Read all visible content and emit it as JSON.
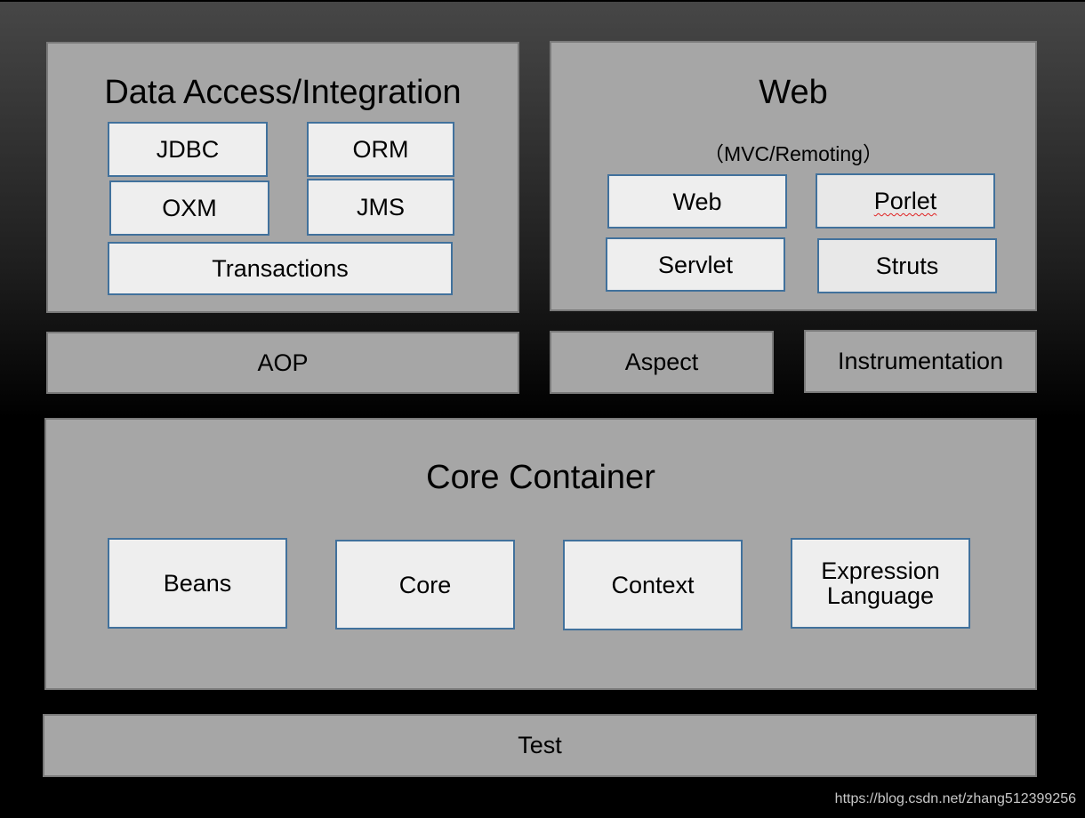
{
  "data_access": {
    "title": "Data Access/Integration",
    "items": [
      "JDBC",
      "ORM",
      "OXM",
      "JMS",
      "Transactions"
    ]
  },
  "web": {
    "title": "Web",
    "subtitle": "（MVC/Remoting）",
    "items": [
      "Web",
      "Porlet",
      "Servlet",
      "Struts"
    ]
  },
  "middle": {
    "aop": "AOP",
    "aspect": "Aspect",
    "instrumentation": "Instrumentation"
  },
  "core_container": {
    "title": "Core Container",
    "items": [
      "Beans",
      "Core",
      "Context",
      "Expression Language"
    ]
  },
  "test": "Test",
  "watermark": "https://blog.csdn.net/zhang512399256",
  "colors": {
    "group_fill": "#a6a6a6",
    "module_fill": "#eeeeee",
    "module_border": "#41719c"
  }
}
